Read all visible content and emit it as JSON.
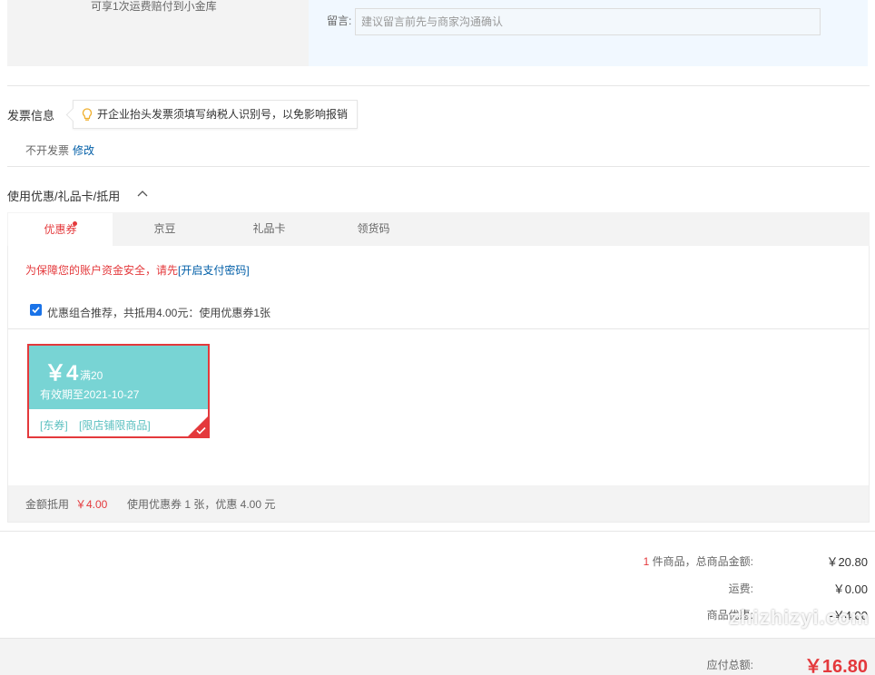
{
  "top": {
    "left_text": "可享1次运费赔付到小金库",
    "remark_label": "留言:",
    "remark_placeholder": "建议留言前先与商家沟通确认"
  },
  "invoice": {
    "title": "发票信息",
    "tip": "开企业抬头发票须填写纳税人识别号，以免影响报销",
    "value": "不开发票",
    "edit_label": "修改"
  },
  "discounts": {
    "title": "使用优惠/礼品卡/抵用",
    "tabs": [
      {
        "label": "优惠券",
        "active": true
      },
      {
        "label": "京豆",
        "active": false
      },
      {
        "label": "礼品卡",
        "active": false
      },
      {
        "label": "领货码",
        "active": false
      }
    ],
    "warning_prefix": "为保障您的账户资金安全，请先",
    "warning_link": "[开启支付密码]",
    "combo_checkbox_checked": true,
    "combo_label": "优惠组合推荐，共抵用4.00元：使用优惠券1张",
    "coupon": {
      "amount": "￥4",
      "condition": "满20",
      "valid": "有效期至2021-10-27",
      "tag1": "[东券]",
      "tag2": "[限店铺限商品]",
      "selected": true
    },
    "summary_label": "金额抵用",
    "summary_amount": "￥4.00",
    "summary_desc": "使用优惠券 1 张，优惠 4.00 元"
  },
  "totals": {
    "count": "1",
    "goods_label": "件商品，总商品金额:",
    "goods_value": "￥20.80",
    "shipping_label": "运费:",
    "shipping_value": "￥0.00",
    "discount_label": "商品优惠:",
    "discount_value": "-￥4.00",
    "payable_label": "应付总额:",
    "payable_value": "￥16.80"
  },
  "watermark": "zhizhizyi.com",
  "colors": {
    "accent": "#e4393c",
    "link": "#005ea7",
    "coupon": "#78d4d4"
  }
}
